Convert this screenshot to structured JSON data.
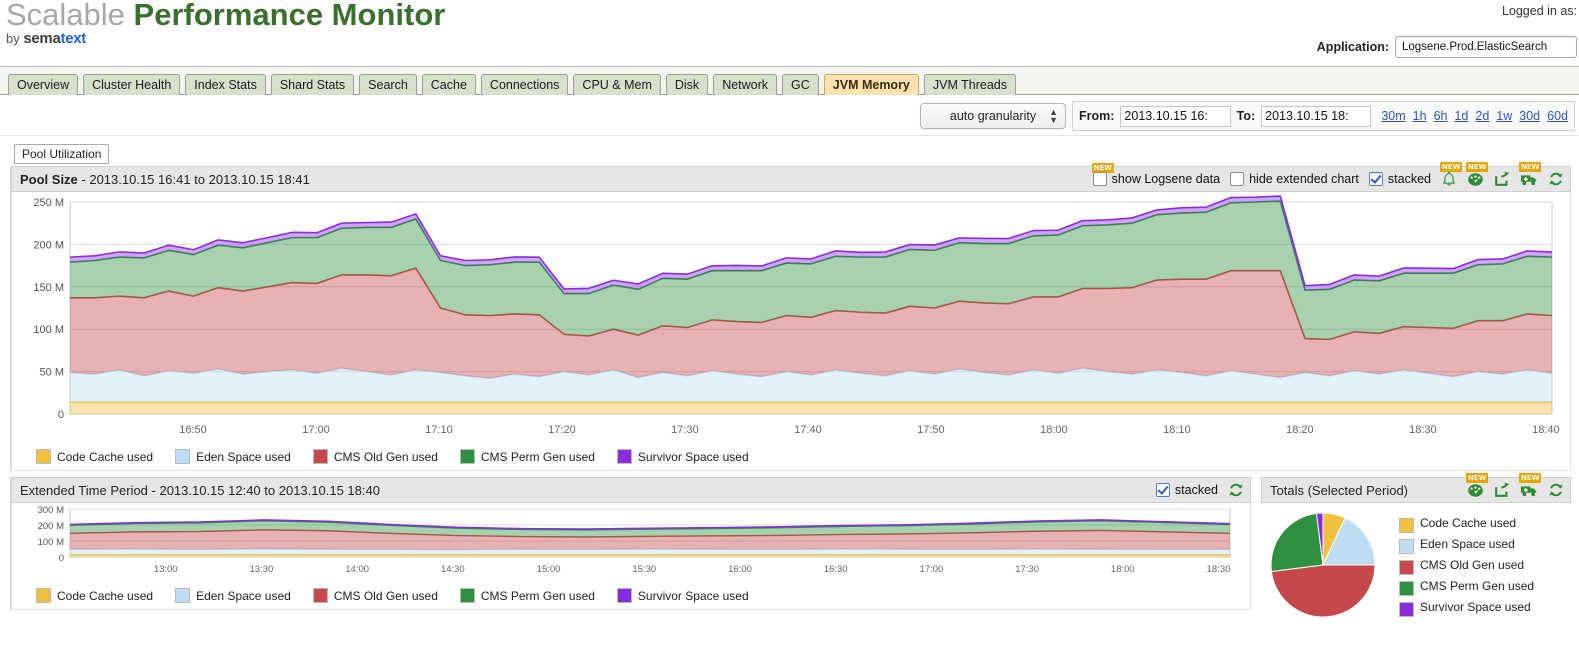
{
  "header": {
    "logo_scalable": "Scalable",
    "logo_performance": "Performance Monitor",
    "logo_by": "by ",
    "logo_sema": "sema",
    "logo_text": "text",
    "logged_in_as": "Logged in as:",
    "application_label": "Application:",
    "application_value": "Logsene.Prod.ElasticSearch"
  },
  "tabs": [
    {
      "label": "Overview",
      "active": false
    },
    {
      "label": "Cluster Health",
      "active": false
    },
    {
      "label": "Index Stats",
      "active": false
    },
    {
      "label": "Shard Stats",
      "active": false
    },
    {
      "label": "Search",
      "active": false
    },
    {
      "label": "Cache",
      "active": false
    },
    {
      "label": "Connections",
      "active": false
    },
    {
      "label": "CPU & Mem",
      "active": false
    },
    {
      "label": "Disk",
      "active": false
    },
    {
      "label": "Network",
      "active": false
    },
    {
      "label": "GC",
      "active": false
    },
    {
      "label": "JVM Memory",
      "active": true
    },
    {
      "label": "JVM Threads",
      "active": false
    }
  ],
  "toolbar": {
    "granularity": "auto granularity",
    "from_label": "From:",
    "from_value": "2013.10.15  16:",
    "to_label": "To:",
    "to_value": "2013.10.15  18:",
    "quick_ranges": [
      "30m",
      "1h",
      "6h",
      "1d",
      "2d",
      "1w",
      "30d",
      "60d"
    ]
  },
  "section": {
    "subtab": "Pool Utilization"
  },
  "main_panel": {
    "title_bold": "Pool Size",
    "title_rest": " - 2013.10.15 16:41 to 2013.10.15 18:41",
    "show_logsene": "show Logsene data",
    "hide_extended": "hide extended chart",
    "stacked": "stacked",
    "new_badge": "NEW",
    "icons": [
      "bell-icon",
      "gauge-icon",
      "share-icon",
      "ambulance-icon",
      "refresh-icon"
    ]
  },
  "extended_panel": {
    "title": "Extended Time Period - 2013.10.15 12:40 to 2013.10.15 18:40",
    "stacked": "stacked"
  },
  "totals_panel": {
    "title": "Totals (Selected Period)",
    "new_badge": "NEW",
    "icons": [
      "gauge-icon",
      "share-icon",
      "ambulance-icon",
      "refresh-icon"
    ]
  },
  "series_colors": {
    "code_cache": "#f0c040",
    "eden_space": "#bcddf2",
    "cms_old_gen": "#c5484a",
    "cms_perm_gen": "#2e9140",
    "survivor_space": "#8a2be2"
  },
  "chart_data": [
    {
      "type": "area",
      "id": "pool-size-main",
      "title": "Pool Size - 2013.10.15 16:41 to 2013.10.15 18:41",
      "stacked": true,
      "xlabel": "",
      "ylabel": "",
      "ylim": [
        0,
        250000000
      ],
      "yticks": [
        0,
        50000000,
        100000000,
        150000000,
        200000000,
        250000000
      ],
      "ytick_labels": [
        "0",
        "50 M",
        "100 M",
        "150 M",
        "200 M",
        "250 M"
      ],
      "grid": true,
      "legend_position": "bottom",
      "xtick_labels": [
        "16:50",
        "17:00",
        "17:10",
        "17:20",
        "17:30",
        "17:40",
        "17:50",
        "18:00",
        "18:10",
        "18:20",
        "18:30",
        "18:40"
      ],
      "x": [
        "16:41",
        "16:43",
        "16:45",
        "16:47",
        "16:49",
        "16:51",
        "16:53",
        "16:55",
        "16:57",
        "16:59",
        "17:01",
        "17:03",
        "17:05",
        "17:07",
        "17:09",
        "17:11",
        "17:13",
        "17:15",
        "17:17",
        "17:19",
        "17:21",
        "17:23",
        "17:25",
        "17:27",
        "17:29",
        "17:31",
        "17:33",
        "17:35",
        "17:37",
        "17:39",
        "17:41",
        "17:43",
        "17:45",
        "17:47",
        "17:49",
        "17:51",
        "17:53",
        "17:55",
        "17:57",
        "17:59",
        "18:01",
        "18:03",
        "18:05",
        "18:07",
        "18:09",
        "18:11",
        "18:13",
        "18:15",
        "18:17",
        "18:19",
        "18:21",
        "18:23",
        "18:25",
        "18:27",
        "18:29",
        "18:31",
        "18:33",
        "18:35",
        "18:37",
        "18:39",
        "18:41"
      ],
      "series": [
        {
          "name": "Code Cache used",
          "color": "#f0c040",
          "values": [
            14000000,
            14000000,
            14000000,
            14000000,
            14000000,
            14000000,
            14000000,
            14000000,
            14000000,
            14000000,
            14000000,
            14000000,
            14000000,
            14000000,
            14000000,
            14000000,
            14000000,
            14000000,
            14000000,
            14000000,
            14000000,
            14000000,
            14000000,
            14000000,
            14000000,
            14000000,
            14000000,
            14000000,
            14000000,
            14000000,
            14000000,
            14000000,
            14000000,
            14000000,
            14000000,
            14000000,
            14000000,
            14000000,
            14000000,
            14000000,
            14000000,
            14000000,
            14000000,
            14000000,
            14000000,
            14000000,
            14000000,
            14000000,
            14000000,
            14000000,
            14000000,
            14000000,
            14000000,
            14000000,
            14000000,
            14000000,
            14000000,
            14000000,
            14000000,
            14000000,
            14000000
          ]
        },
        {
          "name": "Eden Space used",
          "color": "#bcddf2",
          "values": [
            35000000,
            33000000,
            38000000,
            31000000,
            37000000,
            34000000,
            39000000,
            33000000,
            36000000,
            38000000,
            34000000,
            40000000,
            36000000,
            32000000,
            38000000,
            35000000,
            31000000,
            28000000,
            33000000,
            30000000,
            36000000,
            32000000,
            38000000,
            29000000,
            35000000,
            31000000,
            37000000,
            33000000,
            30000000,
            36000000,
            32000000,
            38000000,
            34000000,
            31000000,
            37000000,
            33000000,
            39000000,
            35000000,
            32000000,
            38000000,
            34000000,
            40000000,
            36000000,
            33000000,
            38000000,
            35000000,
            31000000,
            37000000,
            33000000,
            29000000,
            35000000,
            31000000,
            37000000,
            33000000,
            38000000,
            34000000,
            30000000,
            36000000,
            33000000,
            38000000,
            34000000
          ]
        },
        {
          "name": "CMS Old Gen used",
          "color": "#c5484a",
          "values": [
            88000000,
            90000000,
            87000000,
            92000000,
            94000000,
            91000000,
            96000000,
            98000000,
            100000000,
            103000000,
            106000000,
            110000000,
            114000000,
            117000000,
            120000000,
            76000000,
            72000000,
            74000000,
            71000000,
            73000000,
            44000000,
            46000000,
            48000000,
            50000000,
            55000000,
            57000000,
            60000000,
            62000000,
            64000000,
            66000000,
            68000000,
            70000000,
            72000000,
            74000000,
            76000000,
            78000000,
            80000000,
            82000000,
            84000000,
            86000000,
            90000000,
            94000000,
            98000000,
            102000000,
            106000000,
            110000000,
            114000000,
            118000000,
            122000000,
            126000000,
            40000000,
            43000000,
            46000000,
            48000000,
            51000000,
            54000000,
            57000000,
            60000000,
            63000000,
            66000000,
            68000000
          ]
        },
        {
          "name": "CMS Perm Gen used",
          "color": "#2e9140",
          "values": [
            42000000,
            44000000,
            46000000,
            47000000,
            48000000,
            49000000,
            50000000,
            51000000,
            52000000,
            53000000,
            54000000,
            55000000,
            56000000,
            57000000,
            58000000,
            56000000,
            58000000,
            60000000,
            61000000,
            62000000,
            48000000,
            50000000,
            52000000,
            54000000,
            56000000,
            57000000,
            58000000,
            60000000,
            61000000,
            62000000,
            63000000,
            64000000,
            65000000,
            66000000,
            67000000,
            68000000,
            69000000,
            70000000,
            71000000,
            72000000,
            73000000,
            74000000,
            75000000,
            76000000,
            77000000,
            78000000,
            79000000,
            80000000,
            81000000,
            82000000,
            57000000,
            59000000,
            61000000,
            62000000,
            63000000,
            64000000,
            65000000,
            66000000,
            67000000,
            68000000,
            69000000
          ]
        },
        {
          "name": "Survivor Space used",
          "color": "#8a2be2",
          "values": [
            6000000,
            5500000,
            6200000,
            5800000,
            6100000,
            5700000,
            6300000,
            5900000,
            6000000,
            6200000,
            5800000,
            6100000,
            5700000,
            6300000,
            5900000,
            5500000,
            6000000,
            5800000,
            6200000,
            5900000,
            5500000,
            6100000,
            5700000,
            6300000,
            5900000,
            6000000,
            5800000,
            6200000,
            5600000,
            6100000,
            5900000,
            6300000,
            5700000,
            6000000,
            5800000,
            6200000,
            5600000,
            6100000,
            5900000,
            6300000,
            5700000,
            6000000,
            5800000,
            6200000,
            5600000,
            6100000,
            5900000,
            6300000,
            5700000,
            6000000,
            5400000,
            5800000,
            6000000,
            5600000,
            6200000,
            5900000,
            5500000,
            6100000,
            5800000,
            6300000,
            6000000
          ]
        }
      ]
    },
    {
      "type": "area",
      "id": "pool-size-extended",
      "title": "Extended Time Period - 2013.10.15 12:40 to 2013.10.15 18:40",
      "stacked": true,
      "ylim": [
        0,
        300000000
      ],
      "yticks": [
        0,
        100000000,
        200000000,
        300000000
      ],
      "ytick_labels": [
        "0",
        "100 M",
        "200 M",
        "300 M"
      ],
      "legend_position": "bottom",
      "xtick_labels": [
        "13:00",
        "13:30",
        "14:00",
        "14:30",
        "15:00",
        "15:30",
        "16:00",
        "16:30",
        "17:00",
        "17:30",
        "18:00",
        "18:30"
      ],
      "x": [
        "12:40",
        "13:00",
        "13:20",
        "13:40",
        "14:00",
        "14:20",
        "14:40",
        "15:00",
        "15:20",
        "15:40",
        "16:00",
        "16:20",
        "16:40",
        "17:00",
        "17:20",
        "17:40",
        "18:00",
        "18:20",
        "18:40"
      ],
      "series": [
        {
          "name": "Code Cache used",
          "color": "#f0c040",
          "values": [
            14000000,
            14000000,
            14000000,
            14000000,
            14000000,
            14000000,
            14000000,
            14000000,
            14000000,
            14000000,
            14000000,
            14000000,
            14000000,
            14000000,
            14000000,
            14000000,
            14000000,
            14000000,
            14000000
          ]
        },
        {
          "name": "Eden Space used",
          "color": "#bcddf2",
          "values": [
            34000000,
            35000000,
            33000000,
            36000000,
            34000000,
            33000000,
            32000000,
            34000000,
            33000000,
            35000000,
            34000000,
            33000000,
            35000000,
            34000000,
            33000000,
            35000000,
            34000000,
            33000000,
            34000000
          ]
        },
        {
          "name": "CMS Old Gen used",
          "color": "#c5484a",
          "values": [
            100000000,
            108000000,
            112000000,
            120000000,
            116000000,
            100000000,
            88000000,
            80000000,
            78000000,
            80000000,
            84000000,
            88000000,
            92000000,
            96000000,
            104000000,
            112000000,
            118000000,
            110000000,
            100000000
          ]
        },
        {
          "name": "CMS Perm Gen used",
          "color": "#2e9140",
          "values": [
            50000000,
            52000000,
            54000000,
            56000000,
            54000000,
            50000000,
            46000000,
            44000000,
            44000000,
            45000000,
            46000000,
            48000000,
            50000000,
            52000000,
            55000000,
            58000000,
            60000000,
            58000000,
            55000000
          ]
        },
        {
          "name": "Survivor Space used",
          "color": "#8a2be2",
          "values": [
            6000000,
            6000000,
            6000000,
            6000000,
            6000000,
            6000000,
            6000000,
            6000000,
            6000000,
            6000000,
            6000000,
            6000000,
            6000000,
            6000000,
            6000000,
            6000000,
            6000000,
            6000000,
            6000000
          ]
        }
      ]
    },
    {
      "type": "pie",
      "id": "totals-selected-period",
      "title": "Totals (Selected Period)",
      "legend_position": "right",
      "labels": [
        "Code Cache used",
        "Eden Space used",
        "CMS Old Gen used",
        "CMS Perm Gen used",
        "Survivor Space used"
      ],
      "values": [
        7,
        18,
        48,
        25,
        2
      ],
      "colors": [
        "#f0c040",
        "#bcddf2",
        "#c5484a",
        "#2e9140",
        "#8a2be2"
      ]
    }
  ],
  "legend_items": [
    {
      "label": "Code Cache used",
      "color": "#f0c040"
    },
    {
      "label": "Eden Space used",
      "color": "#bcddf2"
    },
    {
      "label": "CMS Old Gen used",
      "color": "#c5484a"
    },
    {
      "label": "CMS Perm Gen used",
      "color": "#2e9140"
    },
    {
      "label": "Survivor Space used",
      "color": "#8a2be2"
    }
  ]
}
